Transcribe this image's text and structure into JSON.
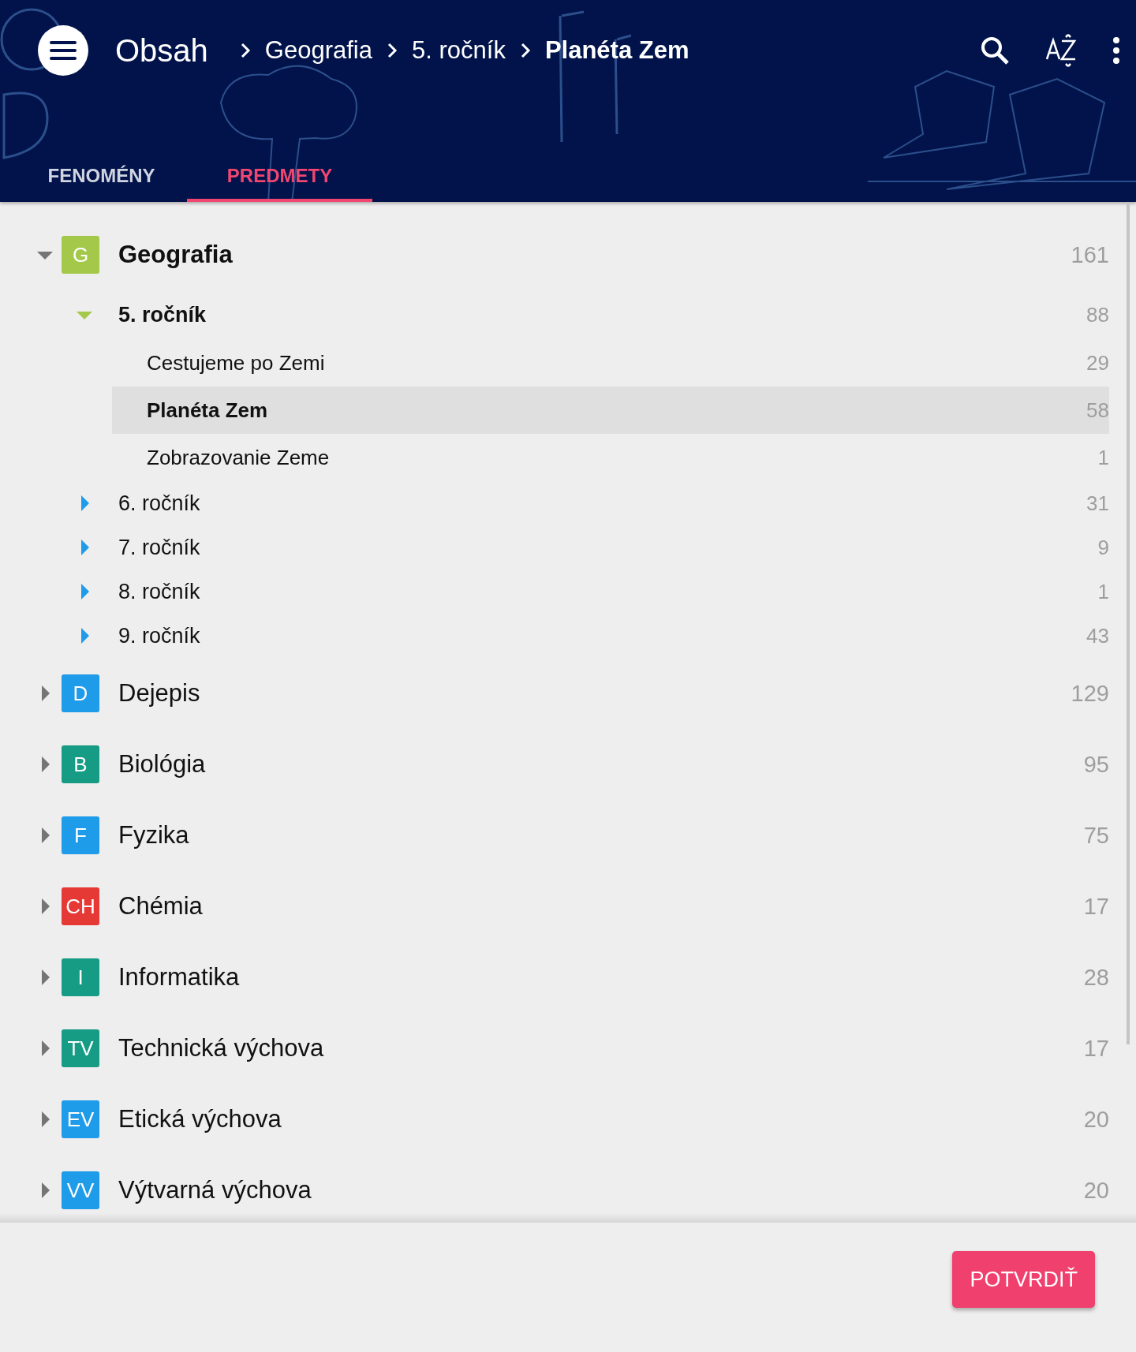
{
  "header": {
    "title": "Obsah",
    "breadcrumbs": [
      {
        "label": "Geografia",
        "current": false
      },
      {
        "label": "5. ročník",
        "current": false
      },
      {
        "label": "Planéta Zem",
        "current": true
      }
    ]
  },
  "tabs": [
    {
      "label": "FENOMÉNY",
      "selected": false
    },
    {
      "label": "PREDMETY",
      "selected": true
    }
  ],
  "subjects": [
    {
      "badge": "G",
      "color": "#a4c94a",
      "name": "Geografia",
      "count": "161",
      "expanded": true,
      "children": [
        {
          "label": "5. ročník",
          "count": "88",
          "expanded": true,
          "children": [
            {
              "label": "Cestujeme po Zemi",
              "count": "29",
              "selected": false
            },
            {
              "label": "Planéta Zem",
              "count": "58",
              "selected": true
            },
            {
              "label": "Zobrazovanie Zeme",
              "count": "1",
              "selected": false
            }
          ]
        },
        {
          "label": "6. ročník",
          "count": "31",
          "expanded": false
        },
        {
          "label": "7. ročník",
          "count": "9",
          "expanded": false
        },
        {
          "label": "8. ročník",
          "count": "1",
          "expanded": false
        },
        {
          "label": "9. ročník",
          "count": "43",
          "expanded": false
        }
      ]
    },
    {
      "badge": "D",
      "color": "#1e9be9",
      "name": "Dejepis",
      "count": "129",
      "expanded": false
    },
    {
      "badge": "B",
      "color": "#169b84",
      "name": "Biológia",
      "count": "95",
      "expanded": false
    },
    {
      "badge": "F",
      "color": "#1e9be9",
      "name": "Fyzika",
      "count": "75",
      "expanded": false
    },
    {
      "badge": "CH",
      "color": "#e53935",
      "name": "Chémia",
      "count": "17",
      "expanded": false
    },
    {
      "badge": "I",
      "color": "#169b84",
      "name": "Informatika",
      "count": "28",
      "expanded": false
    },
    {
      "badge": "TV",
      "color": "#169b84",
      "name": "Technická výchova",
      "count": "17",
      "expanded": false
    },
    {
      "badge": "EV",
      "color": "#1e9be9",
      "name": "Etická výchova",
      "count": "20",
      "expanded": false
    },
    {
      "badge": "VV",
      "color": "#1e9be9",
      "name": "Výtvarná výchova",
      "count": "20",
      "expanded": false
    }
  ],
  "confirm_button": "POTVRDIŤ"
}
